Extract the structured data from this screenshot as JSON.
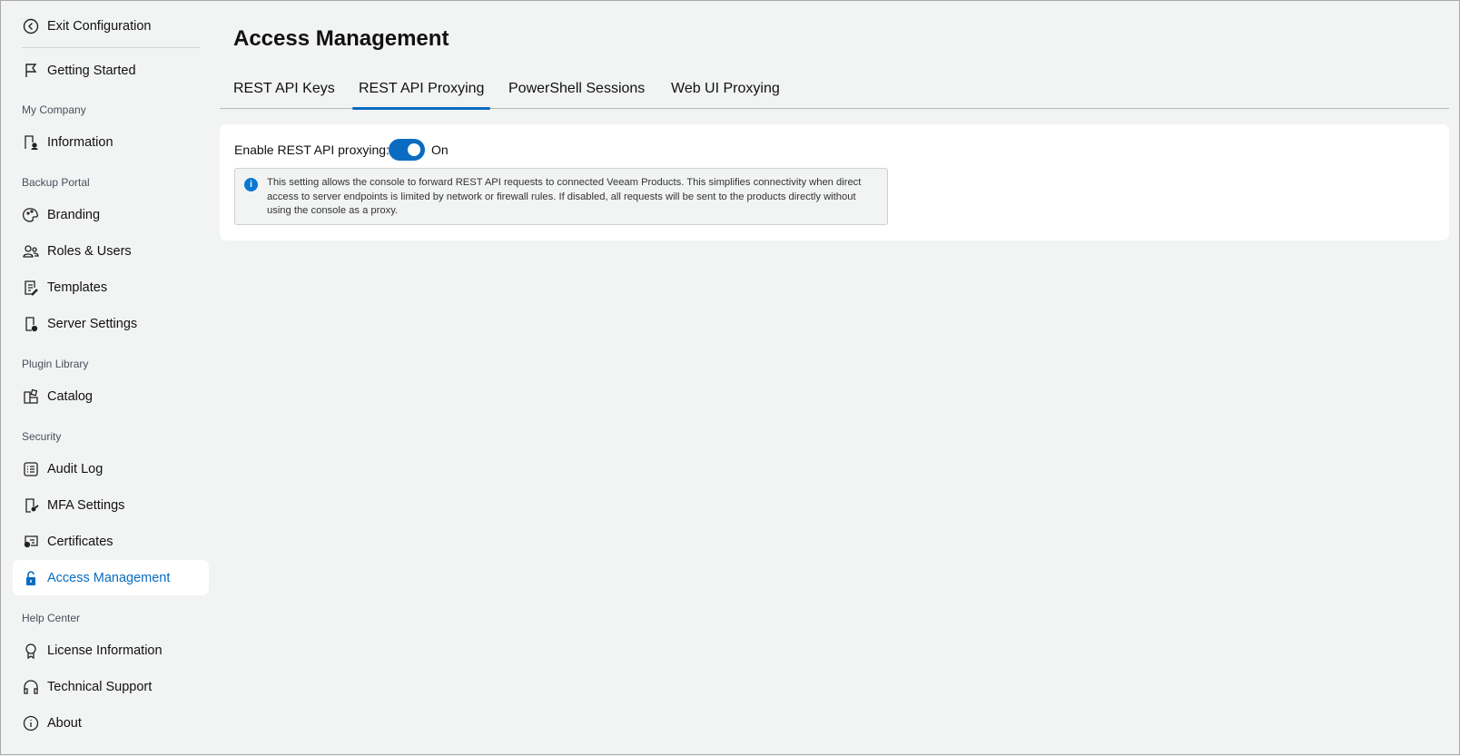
{
  "sidebar": {
    "exit": "Exit Configuration",
    "getting_started": "Getting Started",
    "sections": [
      "My Company",
      "Backup Portal",
      "Plugin Library",
      "Security",
      "Help Center"
    ],
    "items": {
      "information": "Information",
      "branding": "Branding",
      "roles": "Roles & Users",
      "templates": "Templates",
      "server": "Server Settings",
      "catalog": "Catalog",
      "audit": "Audit Log",
      "mfa": "MFA Settings",
      "certificates": "Certificates",
      "access": "Access Management",
      "license": "License Information",
      "support": "Technical Support",
      "about": "About"
    }
  },
  "page": {
    "title": "Access Management",
    "tabs": [
      "REST API Keys",
      "REST API Proxying",
      "PowerShell Sessions",
      "Web UI Proxying"
    ],
    "active_tab": "REST API Proxying",
    "toggle_label": "Enable REST API proxying:",
    "toggle_state": "On",
    "info": "This setting allows the console to forward REST API requests to connected Veeam Products. This simplifies connectivity when direct access to server endpoints is limited by network or firewall rules. If disabled, all requests will be sent to the products directly without using the console as a proxy."
  },
  "colors": {
    "accent": "#0a6cc0"
  }
}
